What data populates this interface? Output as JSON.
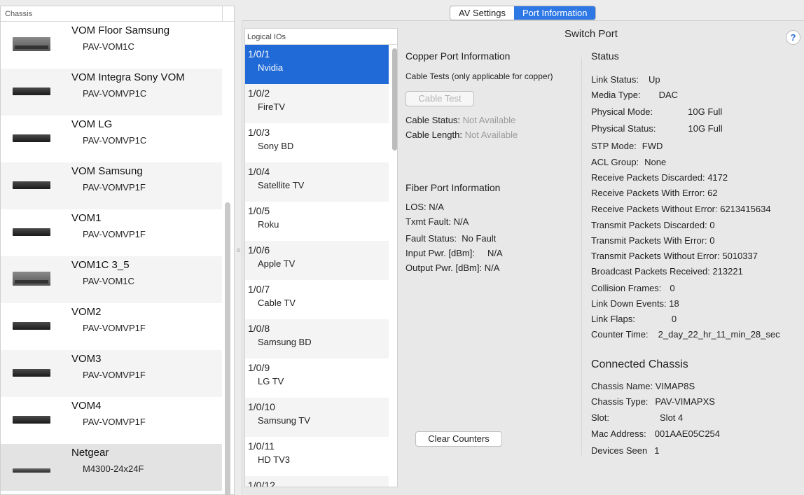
{
  "left_panel": {
    "header": "Chassis",
    "chassis": [
      {
        "name": "VOM Floor Samsung",
        "model": "PAV-VOM1C",
        "icon": "gray"
      },
      {
        "name": "VOM Integra Sony VOM",
        "model": "PAV-VOMVP1C",
        "icon": "black"
      },
      {
        "name": "VOM LG",
        "model": "PAV-VOMVP1C",
        "icon": "black"
      },
      {
        "name": "VOM Samsung",
        "model": "PAV-VOMVP1F",
        "icon": "black"
      },
      {
        "name": "VOM1",
        "model": "PAV-VOMVP1F",
        "icon": "black"
      },
      {
        "name": "VOM1C 3_5",
        "model": "PAV-VOM1C",
        "icon": "gray"
      },
      {
        "name": "VOM2",
        "model": "PAV-VOMVP1F",
        "icon": "black"
      },
      {
        "name": "VOM3",
        "model": "PAV-VOMVP1F",
        "icon": "black"
      },
      {
        "name": "VOM4",
        "model": "PAV-VOMVP1F",
        "icon": "black"
      },
      {
        "name": "Netgear",
        "model": "M4300-24x24F",
        "icon": "rack",
        "selected": true
      }
    ]
  },
  "tabs": [
    {
      "label": "AV Settings",
      "active": false
    },
    {
      "label": "Port Information",
      "active": true
    }
  ],
  "main": {
    "title": "Switch Port",
    "help_label": "?"
  },
  "logical_ios": {
    "header": "Logical IOs",
    "items": [
      {
        "port": "1/0/1",
        "device": "Nvidia",
        "selected": true
      },
      {
        "port": "1/0/2",
        "device": "FireTV"
      },
      {
        "port": "1/0/3",
        "device": "Sony BD"
      },
      {
        "port": "1/0/4",
        "device": "Satellite TV"
      },
      {
        "port": "1/0/5",
        "device": "Roku"
      },
      {
        "port": "1/0/6",
        "device": "Apple TV"
      },
      {
        "port": "1/0/7",
        "device": "Cable TV"
      },
      {
        "port": "1/0/8",
        "device": "Samsung BD"
      },
      {
        "port": "1/0/9",
        "device": "LG TV"
      },
      {
        "port": "1/0/10",
        "device": "Samsung TV"
      },
      {
        "port": "1/0/11",
        "device": "HD TV3"
      },
      {
        "port": "1/0/12",
        "device": ""
      }
    ]
  },
  "copper": {
    "title": "Copper Port Information",
    "cable_tests_label": "Cable Tests (only applicable for copper)",
    "cable_test_button": "Cable Test",
    "cable_status_label": "Cable Status:",
    "cable_status_value": "Not Available",
    "cable_length_label": "Cable Length:",
    "cable_length_value": "Not Available"
  },
  "fiber": {
    "title": "Fiber Port Information",
    "los_label": "LOS:",
    "los_value": "N/A",
    "txmt_label": "Txmt Fault:",
    "txmt_value": "N/A",
    "fault_label": "Fault Status:",
    "fault_value": "No Fault",
    "input_label": "Input Pwr. [dBm]:",
    "input_value": "N/A",
    "output_label": "Output Pwr. [dBm]:",
    "output_value": "N/A"
  },
  "clear_counters_button": "Clear Counters",
  "status": {
    "title": "Status",
    "rows": [
      {
        "label": "Link Status:",
        "value": "Up"
      },
      {
        "label": "Media Type:",
        "value": "DAC"
      },
      {
        "label": "Physical Mode:",
        "value": "10G Full"
      },
      {
        "label": "Physical Status:",
        "value": "10G Full"
      },
      {
        "label": "STP Mode:",
        "value": "FWD"
      },
      {
        "label": "ACL Group:",
        "value": "None"
      },
      {
        "label": "Receive Packets Discarded:",
        "value": "4172"
      },
      {
        "label": "Receive Packets With Error:",
        "value": "62"
      },
      {
        "label": "Receive Packets Without Error:",
        "value": "6213415634"
      },
      {
        "label": "Transmit Packets Discarded:",
        "value": "0"
      },
      {
        "label": "Transmit Packets With Error:",
        "value": "0"
      },
      {
        "label": "Transmit Packets Without Error:",
        "value": "5010337"
      },
      {
        "label": "Broadcast Packets Received:",
        "value": "213221"
      },
      {
        "label": "Collision Frames:",
        "value": "0"
      },
      {
        "label": "Link Down Events:",
        "value": "18"
      },
      {
        "label": "Link Flaps:",
        "value": "0"
      },
      {
        "label": "Counter Time:",
        "value": "2_day_22_hr_11_min_28_sec"
      }
    ]
  },
  "connected": {
    "title": "Connected Chassis",
    "rows": [
      {
        "label": "Chassis Name:",
        "value": "VIMAP8S"
      },
      {
        "label": "Chassis Type:",
        "value": "PAV-VIMAPXS"
      },
      {
        "label": "Slot:",
        "value": "Slot 4"
      },
      {
        "label": "Mac Address:",
        "value": "001AAE05C254"
      },
      {
        "label": "Devices Seen",
        "value": "1"
      }
    ]
  }
}
